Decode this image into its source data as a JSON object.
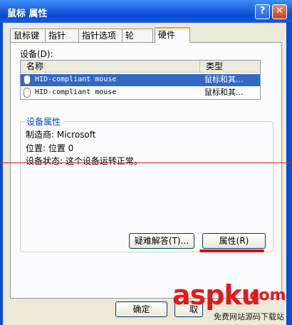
{
  "window": {
    "title": "鼠标 属性",
    "help": "?",
    "close": "✕"
  },
  "tabs": [
    "鼠标键",
    "指针",
    "指针选项",
    "轮",
    "硬件"
  ],
  "devices": {
    "label": "设备(D):",
    "columns": [
      "名称",
      "类型"
    ],
    "rows": [
      {
        "name": "HID-compliant mouse",
        "type": "鼠标和其...",
        "selected": true
      },
      {
        "name": "HID-compliant mouse",
        "type": "鼠标和其...",
        "selected": false
      }
    ]
  },
  "properties": {
    "group_title": "设备属性",
    "manufacturer": "制造商: Microsoft",
    "location": "位置: 位置 0",
    "status": "设备状态: 这个设备运转正常。"
  },
  "buttons": {
    "troubleshoot": "疑难解答(T)...",
    "properties": "属性(R)",
    "ok": "确定",
    "cancel": "取"
  },
  "watermark": {
    "brand": "aspku",
    "suffix": ".com",
    "tagline": "免费网站源码下载站"
  },
  "colors": {
    "accent": "#316ac5",
    "tab_highlight": "#f5a30f",
    "annotation": "#e00010"
  }
}
